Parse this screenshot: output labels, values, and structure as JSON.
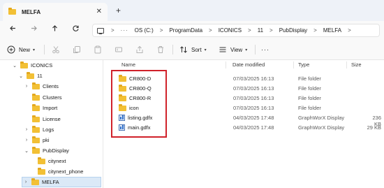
{
  "tab": {
    "title": "MELFA",
    "close_glyph": "✕",
    "new_glyph": "+"
  },
  "address": {
    "more": "···",
    "separator": ">",
    "crumbs": [
      "OS (C:)",
      "ProgramData",
      "ICONICS",
      "11",
      "PubDisplay",
      "MELFA"
    ]
  },
  "toolbar": {
    "new_label": "New",
    "sort_label": "Sort",
    "view_label": "View",
    "more_label": "···"
  },
  "nav": {
    "items": [
      {
        "label": "ICONICS",
        "expanded": true
      },
      {
        "label": "11",
        "expanded": true
      },
      {
        "label": "Clients",
        "expanded": false
      },
      {
        "label": "Clusters",
        "expanded": false
      },
      {
        "label": "Import",
        "expanded": false
      },
      {
        "label": "License",
        "expanded": false
      },
      {
        "label": "Logs",
        "expanded": false
      },
      {
        "label": "pki",
        "expanded": false
      },
      {
        "label": "PubDisplay",
        "expanded": true
      },
      {
        "label": "citynext",
        "expanded": false
      },
      {
        "label": "citynext_phone",
        "expanded": false
      },
      {
        "label": "MELFA",
        "expanded": false,
        "selected": true
      }
    ]
  },
  "columns": {
    "name": "Name",
    "date": "Date modified",
    "type": "Type",
    "size": "Size"
  },
  "files": [
    {
      "name": "CR800-D",
      "date": "07/03/2025 16:13",
      "type": "File folder",
      "size": "",
      "icon": "folder-icon"
    },
    {
      "name": "CR800-Q",
      "date": "07/03/2025 16:13",
      "type": "File folder",
      "size": "",
      "icon": "folder-icon"
    },
    {
      "name": "CR800-R",
      "date": "07/03/2025 16:13",
      "type": "File folder",
      "size": "",
      "icon": "folder-icon"
    },
    {
      "name": "icon",
      "date": "07/03/2025 16:13",
      "type": "File folder",
      "size": "",
      "icon": "folder-icon"
    },
    {
      "name": "listing.gdfx",
      "date": "04/03/2025 17:48",
      "type": "GraphWorX Display",
      "size": "236 KB",
      "icon": "gdfx-file-icon"
    },
    {
      "name": "main.gdfx",
      "date": "04/03/2025 17:48",
      "type": "GraphWorX Display",
      "size": "29 KB",
      "icon": "gdfx-file-icon"
    }
  ],
  "colors": {
    "accent": "#0067c0",
    "folder": "#f2c035",
    "highlight_box": "#d0212a",
    "selection": "#dbe9f7"
  }
}
